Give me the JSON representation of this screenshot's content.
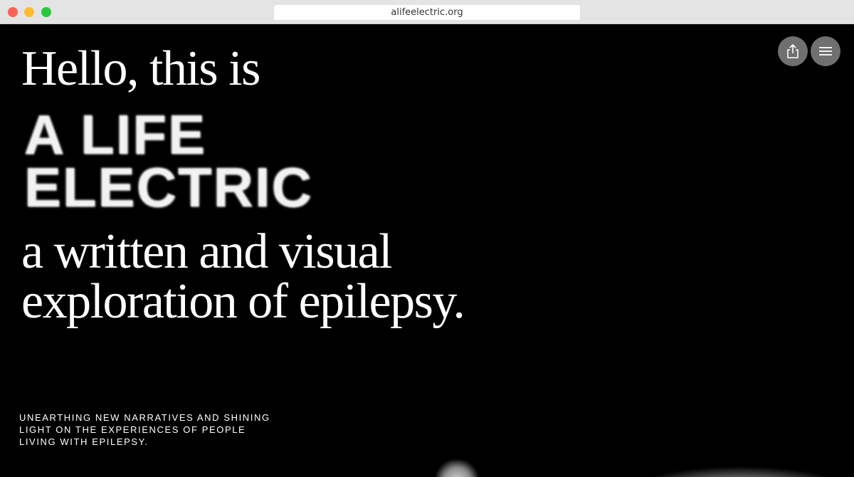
{
  "browser": {
    "url": "alifeelectric.org"
  },
  "hero": {
    "greeting": "Hello, this is",
    "brand_line1": "A LIFE",
    "brand_line2": "ELECTRIC",
    "tagline_line1": "a written and visual",
    "tagline_line2": "exploration of epilepsy."
  },
  "description": {
    "text": "UNEARTHING NEW NARRATIVES AND SHINING LIGHT ON THE EXPERIENCES OF PEOPLE LIVING WITH EPILEPSY."
  },
  "controls": {
    "share_icon": "share-icon",
    "menu_icon": "hamburger-menu-icon"
  },
  "colors": {
    "background": "#000000",
    "text": "#ffffff",
    "button": "#707070"
  }
}
